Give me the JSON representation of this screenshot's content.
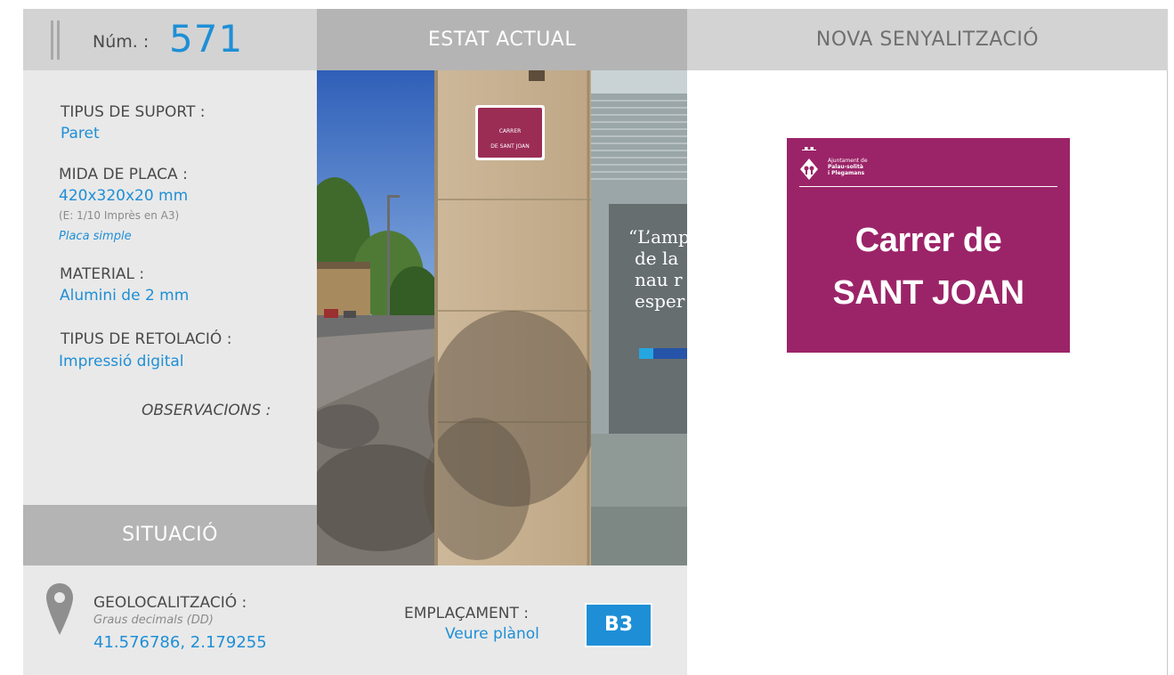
{
  "header": {
    "num_label": "Núm. :",
    "num_value": "571",
    "estat_actual": "ESTAT ACTUAL",
    "nova_senyalitzacio": "NOVA SENYALITZACIÓ"
  },
  "info": {
    "tipus_suport_label": "TIPUS DE SUPORT :",
    "tipus_suport_value": "Paret",
    "mida_placa_label": "MIDA DE PLACA :",
    "mida_placa_value": "420x320x20 mm",
    "mida_placa_scale": "(E: 1/10 Imprès en A3)",
    "mida_placa_type": "Placa simple",
    "material_label": "MATERIAL :",
    "material_value": "Alumini de 2 mm",
    "retolacio_label": "TIPUS DE RETOLACIÓ :",
    "retolacio_value": "Impressió digital",
    "observacions_label": "OBSERVACIONS :"
  },
  "photo": {
    "sign_line1": "CARRER",
    "sign_line2": "DE SANT JOAN",
    "poster_lines": [
      "“L’amp",
      "de la",
      "nau r",
      "esper"
    ]
  },
  "situacio": {
    "title": "SITUACIÓ",
    "geo_label": "GEOLOCALITZACIÓ :",
    "geo_note": "Graus decimals (DD)",
    "geo_value": "41.576786, 2.179255",
    "emplacament_label": "EMPLAÇAMENT :",
    "emplacament_link": "Veure plànol",
    "emplacament_code": "B3"
  },
  "sign": {
    "org_line1": "Ajuntament de",
    "org_line2": "Palau-solità",
    "org_line3": "i Plegamans",
    "line1": "Carrer de",
    "line2": "SANT JOAN"
  },
  "colors": {
    "accent_blue": "#1e8fd6",
    "sign_magenta": "#9b2468",
    "header_dark": "#b4b4b4",
    "header_light": "#d3d3d3",
    "panel": "#e9e9e9"
  },
  "icons": [
    "map-pin-icon",
    "crest-icon"
  ]
}
